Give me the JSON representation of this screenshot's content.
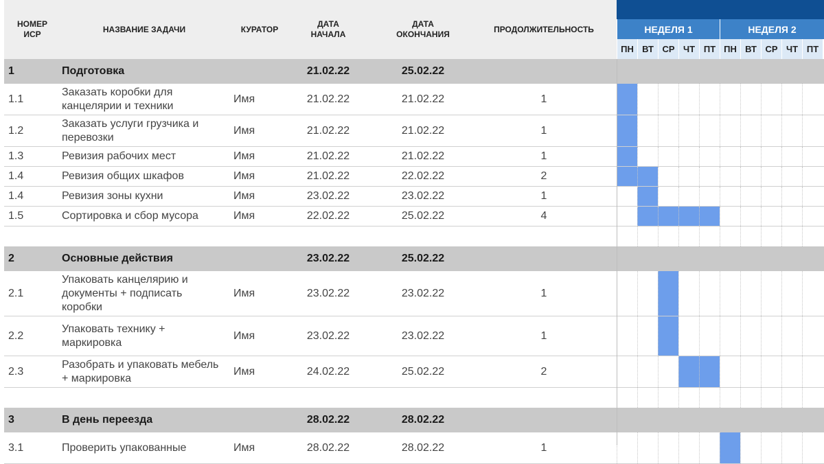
{
  "header": {
    "col_num": "НОМЕР\nИСР",
    "col_name": "НАЗВАНИЕ ЗАДАЧИ",
    "col_owner": "КУРАТОР",
    "col_start": "ДАТА\nНАЧАЛА",
    "col_end": "ДАТА\nОКОНЧАНИЯ",
    "col_duration": "ПРОДОЛЖИТЕЛЬНОСТЬ",
    "weeks": [
      "НЕДЕЛЯ 1",
      "НЕДЕЛЯ 2"
    ],
    "days": [
      "ПН",
      "ВТ",
      "СР",
      "ЧТ",
      "ПТ",
      "ПН",
      "ВТ",
      "СР",
      "ЧТ",
      "ПТ"
    ]
  },
  "colors": {
    "header_bar": "#0f4f93",
    "week_band": "#3d82c8",
    "day_band": "#dce9f6",
    "section_row": "#c9c9c9",
    "gantt_fill": "#6d9eeb"
  },
  "rows": [
    {
      "type": "section",
      "num": "1",
      "name": "Подготовка",
      "owner": "",
      "start": "21.02.22",
      "end": "25.02.22",
      "duration": "",
      "gantt": []
    },
    {
      "type": "task",
      "num": "1.1",
      "name": "Заказать коробки для канцелярии и техники",
      "owner": "Имя",
      "start": "21.02.22",
      "end": "21.02.22",
      "duration": "1",
      "gantt": [
        0
      ]
    },
    {
      "type": "task",
      "num": "1.2",
      "name": "Заказать услуги грузчика и перевозки",
      "owner": "Имя",
      "start": "21.02.22",
      "end": "21.02.22",
      "duration": "1",
      "gantt": [
        0
      ]
    },
    {
      "type": "task",
      "num": "1.3",
      "name": "Ревизия рабочих мест",
      "owner": "Имя",
      "start": "21.02.22",
      "end": "21.02.22",
      "duration": "1",
      "gantt": [
        0
      ]
    },
    {
      "type": "task",
      "num": "1.4",
      "name": "Ревизия общих шкафов",
      "owner": "Имя",
      "start": "21.02.22",
      "end": "22.02.22",
      "duration": "2",
      "gantt": [
        0,
        1
      ]
    },
    {
      "type": "task",
      "num": "1.4",
      "name": "Ревизия зоны кухни",
      "owner": "Имя",
      "start": "23.02.22",
      "end": "23.02.22",
      "duration": "1",
      "gantt": [
        1
      ]
    },
    {
      "type": "task",
      "num": "1.5",
      "name": "Сортировка и сбор мусора",
      "owner": "Имя",
      "start": "22.02.22",
      "end": "25.02.22",
      "duration": "4",
      "gantt": [
        1,
        2,
        3,
        4
      ]
    },
    {
      "type": "blank"
    },
    {
      "type": "section",
      "num": "2",
      "name": "Основные действия",
      "owner": "",
      "start": "23.02.22",
      "end": "25.02.22",
      "duration": "",
      "gantt": []
    },
    {
      "type": "task",
      "num": "2.1",
      "name": "Упаковать канцелярию и документы + подписать коробки",
      "owner": "Имя",
      "start": "23.02.22",
      "end": "23.02.22",
      "duration": "1",
      "gantt": [
        2
      ]
    },
    {
      "type": "task",
      "num": "2.2",
      "name": "Упаковать технику + маркировка",
      "owner": "Имя",
      "start": "23.02.22",
      "end": "23.02.22",
      "duration": "1",
      "gantt": [
        2
      ]
    },
    {
      "type": "task",
      "num": "2.3",
      "name": "Разобрать и упаковать мебель + маркировка",
      "owner": "Имя",
      "start": "24.02.22",
      "end": "25.02.22",
      "duration": "2",
      "gantt": [
        3,
        4
      ]
    },
    {
      "type": "blank"
    },
    {
      "type": "section",
      "num": "3",
      "name": "В день переезда",
      "owner": "",
      "start": "28.02.22",
      "end": "28.02.22",
      "duration": "",
      "gantt": []
    },
    {
      "type": "task",
      "num": "3.1",
      "name": "Проверить упакованные",
      "owner": "Имя",
      "start": "28.02.22",
      "end": "28.02.22",
      "duration": "1",
      "gantt": [
        5
      ]
    }
  ]
}
